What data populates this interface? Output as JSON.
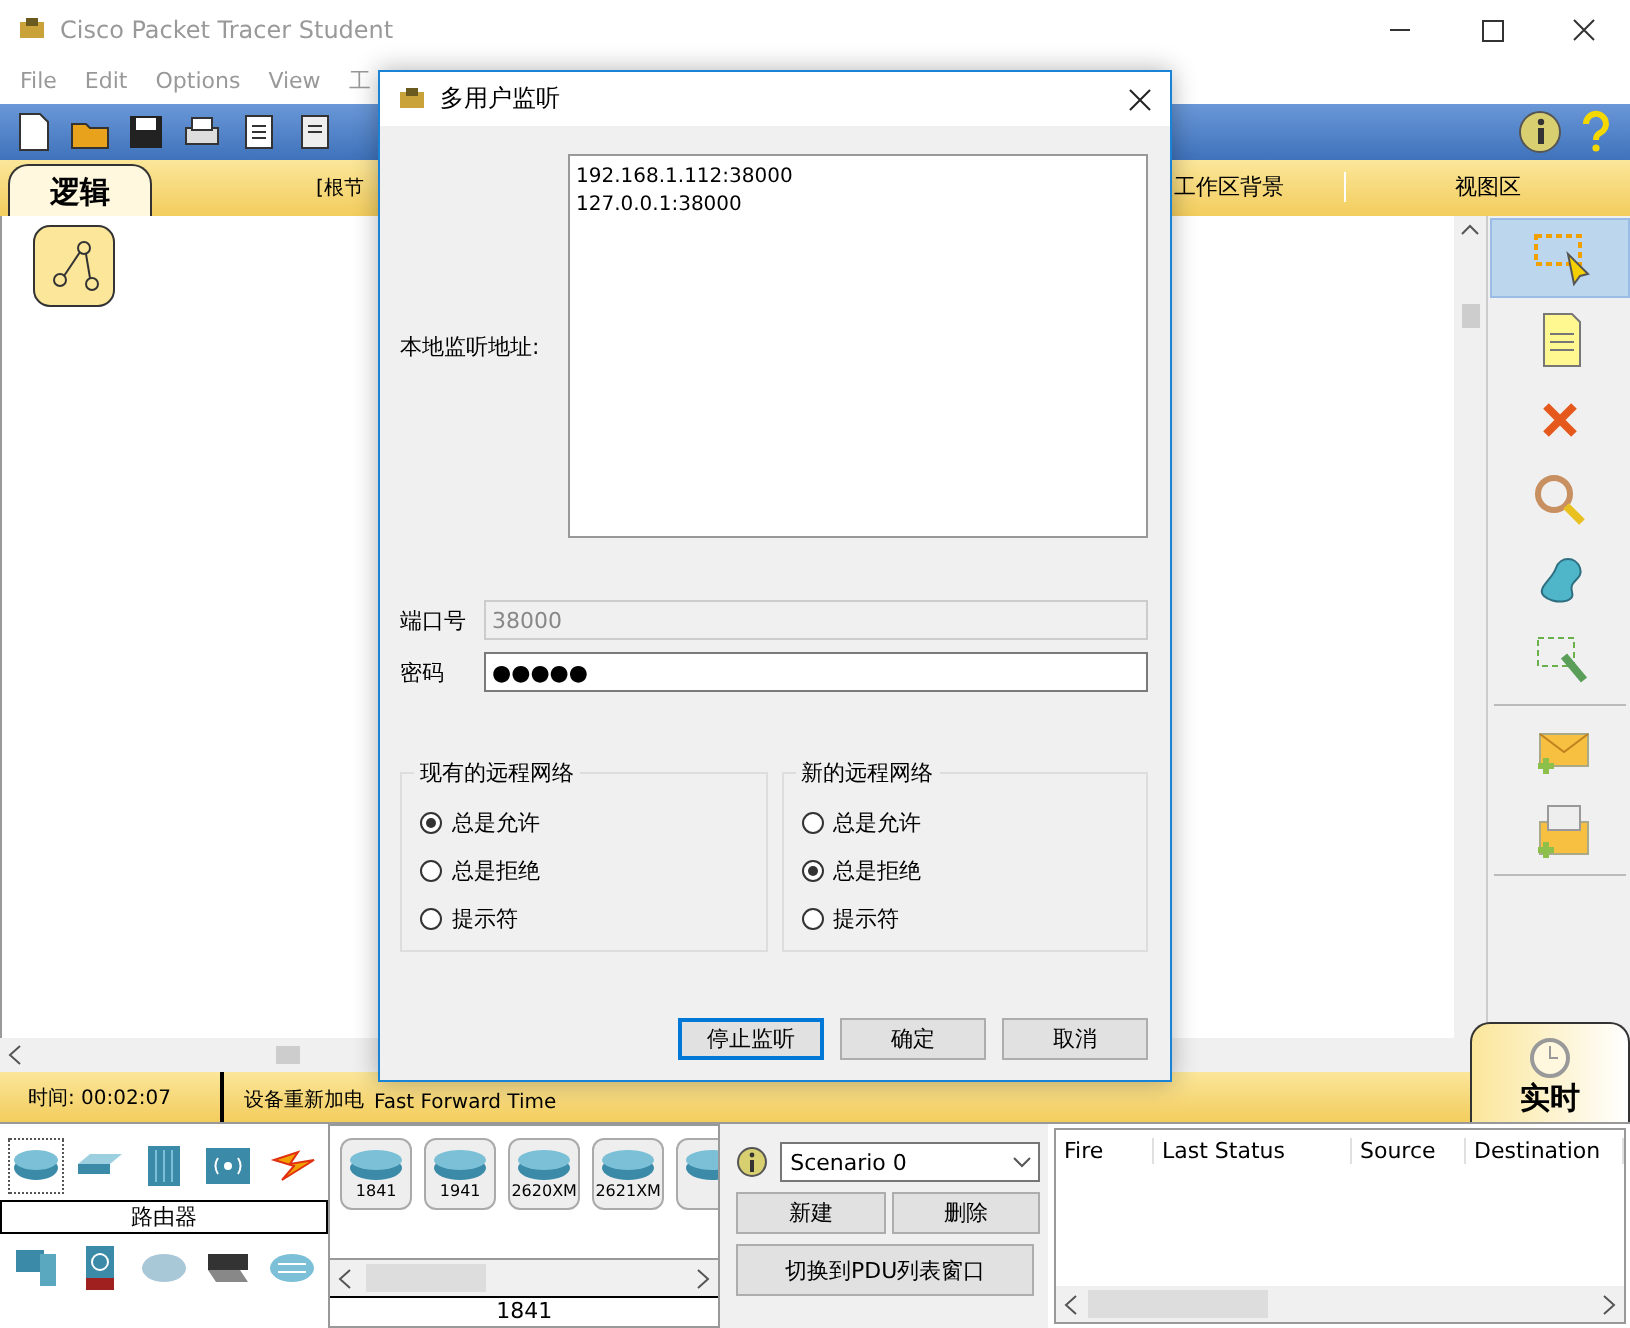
{
  "app": {
    "title": "Cisco Packet Tracer Student",
    "menu": [
      "File",
      "Edit",
      "Options",
      "View",
      "工"
    ]
  },
  "workspace_bar": {
    "tab": "逻辑",
    "items": [
      "[根节",
      "工作区背景",
      "视图区"
    ]
  },
  "tools": [
    {
      "kind": "select",
      "selected": true
    },
    {
      "kind": "note",
      "selected": false
    },
    {
      "kind": "delete",
      "selected": false
    },
    {
      "kind": "inspect",
      "selected": false
    },
    {
      "kind": "shape",
      "selected": false
    },
    {
      "kind": "resize",
      "selected": false
    },
    {
      "kind": "simple-pdu",
      "selected": false
    },
    {
      "kind": "complex-pdu",
      "selected": false
    }
  ],
  "status_bar": {
    "time": "时间: 00:02:07",
    "power": "设备重新加电",
    "fast_forward": "Fast Forward Time",
    "mode_tab": "实时"
  },
  "device_categories": {
    "caption": "路由器",
    "top": [
      {
        "kind": "router",
        "selected": true
      },
      {
        "kind": "switch",
        "selected": false
      },
      {
        "kind": "hub",
        "selected": false
      },
      {
        "kind": "wireless",
        "selected": false
      },
      {
        "kind": "connection",
        "selected": false
      }
    ],
    "bottom": [
      {
        "kind": "end-device"
      },
      {
        "kind": "security"
      },
      {
        "kind": "wan"
      },
      {
        "kind": "custom"
      },
      {
        "kind": "multiuser"
      }
    ]
  },
  "device_models": {
    "items": [
      "1841",
      "1941",
      "2620XM",
      "2621XM"
    ],
    "caption": "1841"
  },
  "scenario": {
    "value": "Scenario 0",
    "buttons": [
      "新建",
      "删除"
    ],
    "toggle": "切换到PDU列表窗口"
  },
  "pdu_table": {
    "columns": [
      "Fire",
      "Last Status",
      "Source",
      "Destination"
    ]
  },
  "dialog": {
    "title": "多用户监听",
    "address_label": "本地监听地址:",
    "addresses": [
      "192.168.1.112:38000",
      "127.0.0.1:38000"
    ],
    "port_label": "端口号",
    "port": "38000",
    "port_disabled": true,
    "password_label": "密码",
    "password": "●●●●●",
    "groups": [
      {
        "title": "现有的远程网络",
        "options": [
          {
            "label": "总是允许",
            "selected": true
          },
          {
            "label": "总是拒绝",
            "selected": false
          },
          {
            "label": "提示符",
            "selected": false
          }
        ]
      },
      {
        "title": "新的远程网络",
        "options": [
          {
            "label": "总是允许",
            "selected": false
          },
          {
            "label": "总是拒绝",
            "selected": true
          },
          {
            "label": "提示符",
            "selected": false
          }
        ]
      }
    ],
    "buttons": [
      {
        "label": "停止监听",
        "default": true
      },
      {
        "label": "确定",
        "default": false
      },
      {
        "label": "取消",
        "default": false
      }
    ]
  }
}
